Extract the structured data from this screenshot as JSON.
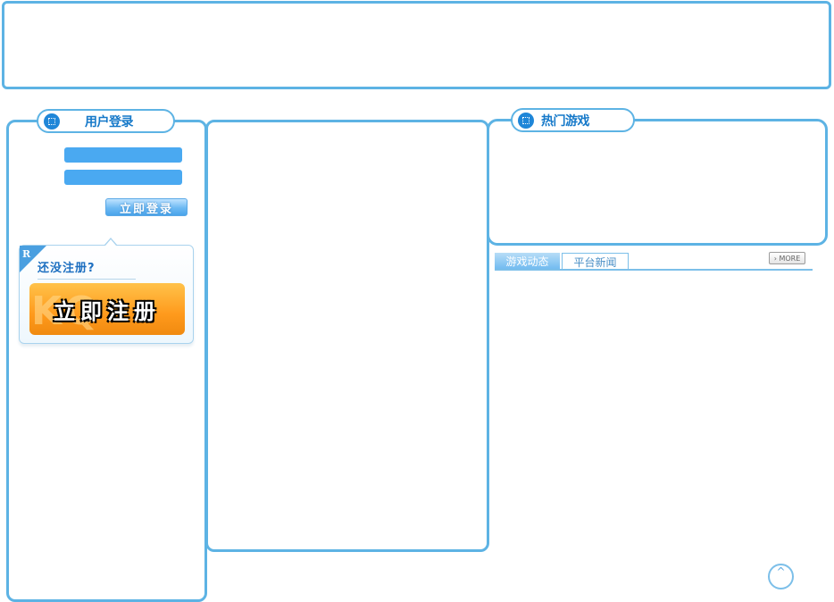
{
  "login": {
    "title": "用户登录",
    "submit_label": "立即登录"
  },
  "register": {
    "question": "还没注册?",
    "button_label": "立即注册",
    "corner_mark": "R"
  },
  "hot_games": {
    "title": "热门游戏"
  },
  "news": {
    "tabs": [
      {
        "label": "游戏动态",
        "active": true
      },
      {
        "label": "平台新闻",
        "active": false
      }
    ],
    "more_label": "› MORE"
  },
  "back_to_top": "^",
  "colors": {
    "accent_border": "#5db3e4",
    "input_fill": "#4aa9f1",
    "register_orange": "#ff9a1c"
  }
}
